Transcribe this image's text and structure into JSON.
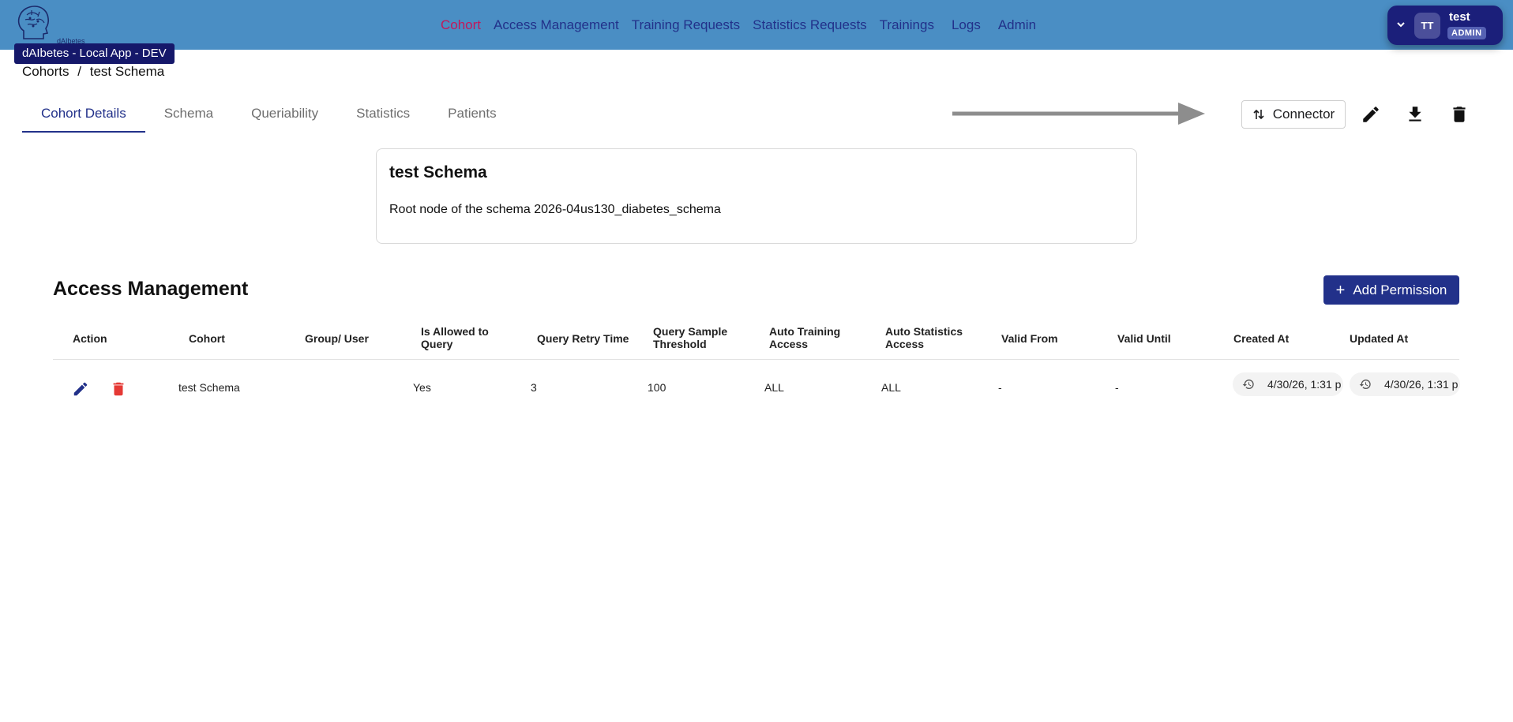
{
  "app": {
    "logo_text": "dAIbetes",
    "env_badge": "dAIbetes - Local App - DEV"
  },
  "nav": {
    "items": [
      "Cohort",
      "Access Management",
      "Training Requests",
      "Statistics Requests",
      "Trainings",
      "Logs",
      "Admin"
    ],
    "active": "Cohort"
  },
  "user": {
    "initials": "TT",
    "name": "test",
    "role": "ADMIN"
  },
  "breadcrumb": {
    "root": "Cohorts",
    "separator": "/",
    "current": "test Schema"
  },
  "tabs": [
    "Cohort Details",
    "Schema",
    "Queriability",
    "Statistics",
    "Patients"
  ],
  "active_tab": "Cohort Details",
  "toolbar": {
    "connector_label": "Connector",
    "icons": [
      "edit-icon",
      "download-icon",
      "delete-icon"
    ]
  },
  "cohort": {
    "title": "test Schema",
    "description": "Root node of the schema 2026-04us130_diabetes_schema"
  },
  "access": {
    "title": "Access Management",
    "add_label": "Add Permission",
    "columns": [
      "Action",
      "Cohort",
      "Group/ User",
      "Is Allowed to Query",
      "Query Retry Time",
      "Query Sample Threshold",
      "Auto Training Access",
      "Auto Statistics Access",
      "Valid From",
      "Valid Until",
      "Created At",
      "Updated At"
    ],
    "rows": [
      {
        "cohort": "test Schema",
        "group_user": "",
        "is_allowed": "Yes",
        "retry_time": "3",
        "sample_threshold": "100",
        "auto_training": "ALL",
        "auto_statistics": "ALL",
        "valid_from": "-",
        "valid_until": "-",
        "created_at": "4/30/26, 1:31 p",
        "updated_at": "4/30/26, 1:31 p"
      }
    ]
  },
  "colors": {
    "header_bg": "#4a8ec4",
    "primary": "#22318a",
    "active_nav": "#c2185b",
    "danger": "#e53935",
    "badge_bg": "#15186a"
  }
}
